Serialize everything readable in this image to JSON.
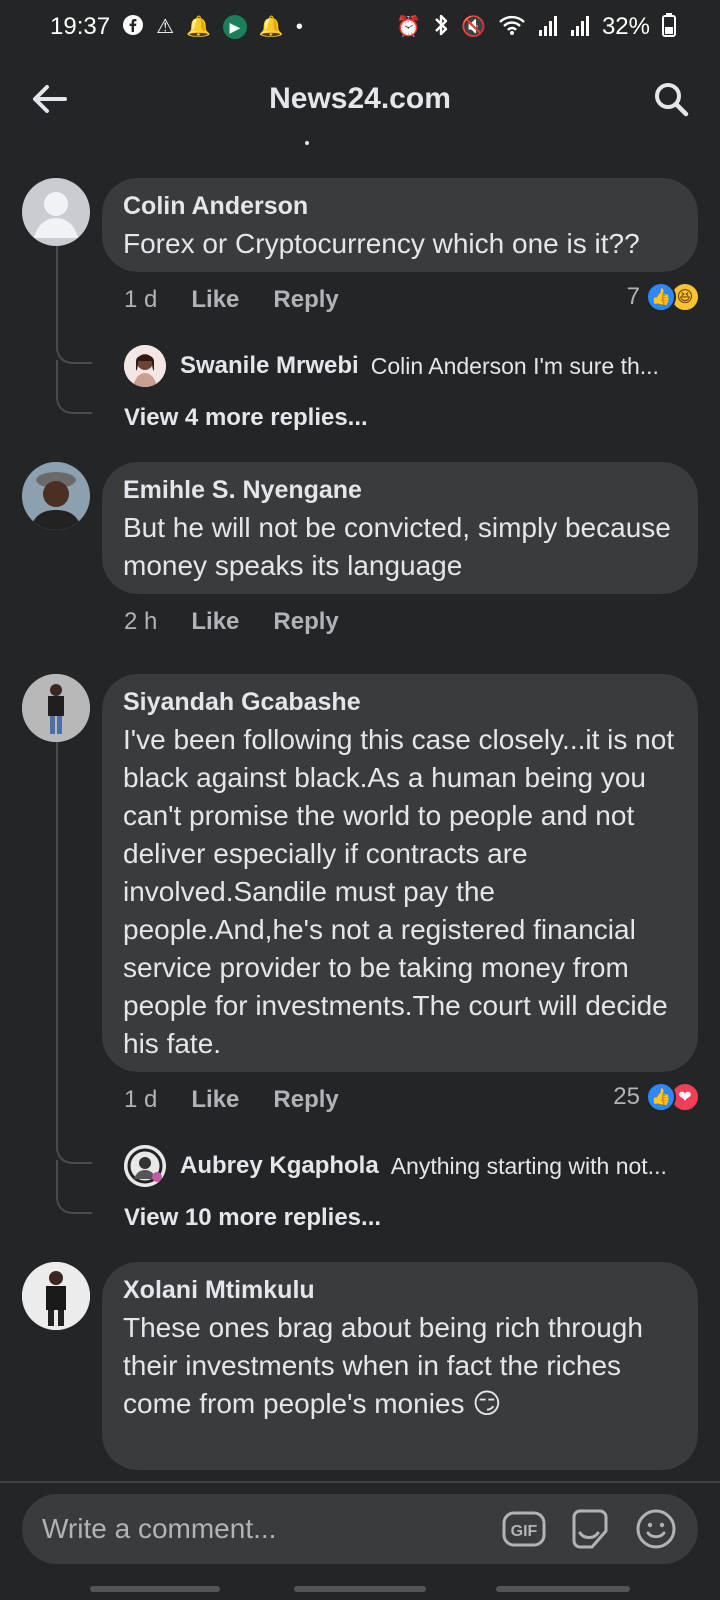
{
  "status_bar": {
    "time": "19:37",
    "battery": "32%",
    "left_icons": [
      "facebook-icon",
      "alert-icon",
      "bell-icon",
      "app-icon",
      "bell-icon",
      "dot-icon"
    ],
    "right_icons": [
      "alarm-icon",
      "bluetooth-icon",
      "mute-icon",
      "wifi-icon",
      "signal-icon",
      "signal-icon"
    ]
  },
  "header": {
    "title": "News24.com"
  },
  "comments": [
    {
      "author": "Colin Anderson",
      "text": "Forex or Cryptocurrency which one is it??",
      "time": "1 d",
      "like_label": "Like",
      "reply_label": "Reply",
      "reaction_count": "7",
      "reactions": [
        "like",
        "haha"
      ],
      "reply_preview": {
        "author": "Swanile Mrwebi",
        "text": "Colin Anderson I'm sure th..."
      },
      "view_more": "View 4 more replies..."
    },
    {
      "author": "Emihle S. Nyengane",
      "text": "But he will not be convicted, simply because money speaks its language",
      "time": "2 h",
      "like_label": "Like",
      "reply_label": "Reply"
    },
    {
      "author": "Siyandah Gcabashe",
      "text": "I've been following this case closely...it is not black against black.As a human being you can't promise the world to people and not deliver especially if contracts are involved.Sandile must pay the people.And,he's not a registered financial service provider to be taking money from people for investments.The court will decide his fate.",
      "time": "1 d",
      "like_label": "Like",
      "reply_label": "Reply",
      "reaction_count": "25",
      "reactions": [
        "like",
        "love"
      ],
      "reply_preview": {
        "author": "Aubrey Kgaphola",
        "text": "Anything starting with not..."
      },
      "view_more": "View 10 more replies..."
    },
    {
      "author": "Xolani Mtimkulu",
      "text": "These ones brag about being rich through their investments when in fact the riches come from people's monies 😏"
    }
  ],
  "composer": {
    "placeholder": "Write a comment...",
    "gif_label": "GIF"
  },
  "colors": {
    "background": "#242526",
    "bubble": "#3a3b3c",
    "like_blue": "#2d88ff",
    "love_red": "#f33e58",
    "haha_yellow": "#f7c332"
  }
}
